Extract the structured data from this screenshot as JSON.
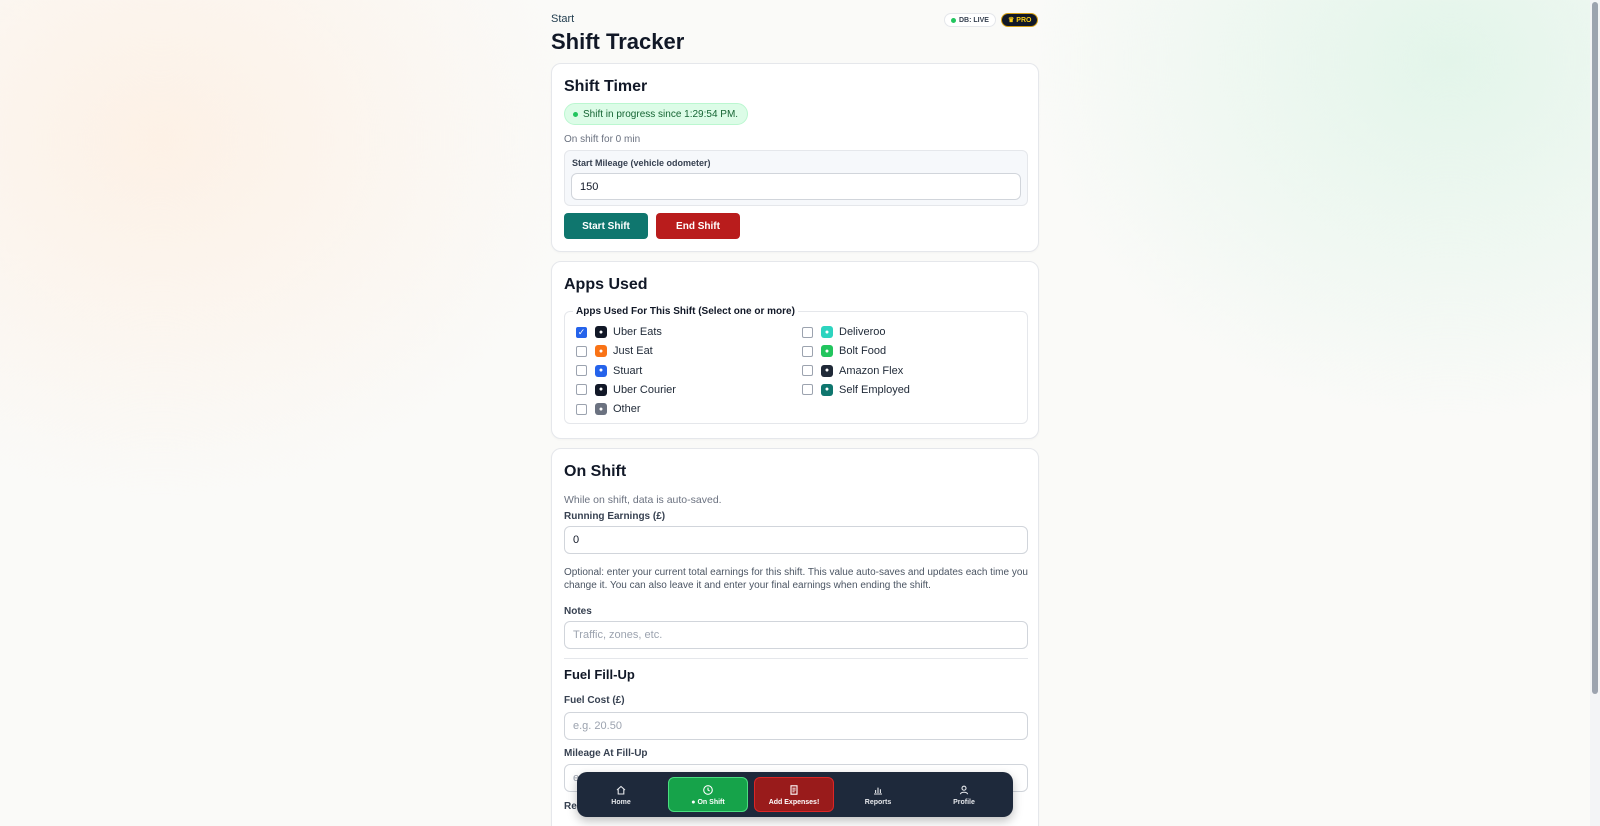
{
  "header": {
    "breadcrumb": "Start",
    "title": "Shift Tracker",
    "db_badge": "DB: LIVE",
    "pro_badge": "PRO"
  },
  "shift_timer": {
    "heading": "Shift Timer",
    "status_pill": "Shift in progress since 1:29:54 PM.",
    "duration_text": "On shift for 0 min",
    "mileage_label": "Start Mileage (vehicle odometer)",
    "mileage_value": "150",
    "start_button": "Start Shift",
    "end_button": "End Shift"
  },
  "apps_used": {
    "heading": "Apps Used",
    "legend": "Apps Used For This Shift (Select one or more)",
    "apps": [
      {
        "label": "Uber Eats",
        "checked": true,
        "icon": "uber-eats-icon",
        "color": "#111827"
      },
      {
        "label": "Deliveroo",
        "checked": false,
        "icon": "deliveroo-icon",
        "color": "#2dd4bf"
      },
      {
        "label": "Just Eat",
        "checked": false,
        "icon": "just-eat-icon",
        "color": "#f97316"
      },
      {
        "label": "Bolt Food",
        "checked": false,
        "icon": "bolt-food-icon",
        "color": "#22c55e"
      },
      {
        "label": "Stuart",
        "checked": false,
        "icon": "stuart-icon",
        "color": "#2563eb"
      },
      {
        "label": "Amazon Flex",
        "checked": false,
        "icon": "amazon-flex-icon",
        "color": "#1f2937"
      },
      {
        "label": "Uber Courier",
        "checked": false,
        "icon": "uber-courier-icon",
        "color": "#111827"
      },
      {
        "label": "Self Employed",
        "checked": false,
        "icon": "self-employed-icon",
        "color": "#0f766e"
      },
      {
        "label": "Other",
        "checked": false,
        "icon": "other-icon",
        "color": "#6b7280"
      }
    ]
  },
  "on_shift": {
    "heading": "On Shift",
    "autosave_note": "While on shift, data is auto-saved.",
    "earnings_label": "Running Earnings (£)",
    "earnings_value": "0",
    "earnings_help": "Optional: enter your current total earnings for this shift. This value auto-saves and updates each time you change it. You can also leave it and enter your final earnings when ending the shift.",
    "notes_label": "Notes",
    "notes_placeholder": "Traffic, zones, etc.",
    "fuel_heading": "Fuel Fill-Up",
    "fuel_cost_label": "Fuel Cost (£)",
    "fuel_cost_placeholder": "e.g. 20.50",
    "fuel_mileage_label": "Mileage At Fill-Up",
    "fuel_mileage_placeholder": "e.g. 1500",
    "receipt_label": "Receipt"
  },
  "bottom_nav": {
    "items": [
      {
        "label": "Home",
        "icon": "home-icon"
      },
      {
        "label": "On Shift",
        "icon": "clock-icon"
      },
      {
        "label": "Add Expenses!",
        "icon": "receipt-icon"
      },
      {
        "label": "Reports",
        "icon": "bar-chart-icon"
      },
      {
        "label": "Profile",
        "icon": "user-icon"
      }
    ]
  },
  "colors": {
    "primary_teal": "#0f766e",
    "danger_red": "#b91c1c",
    "success_green": "#22c55e",
    "nav_bg": "#1e293b",
    "expenses_red": "#991b1b"
  }
}
